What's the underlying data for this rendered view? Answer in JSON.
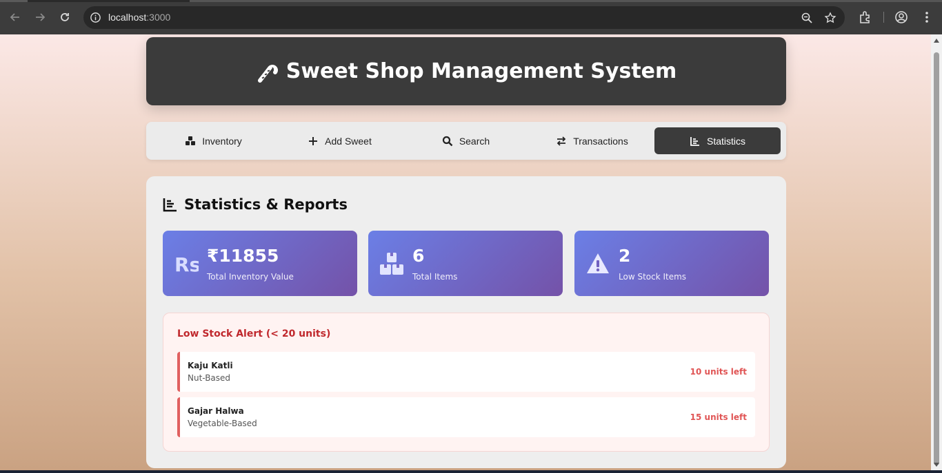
{
  "browser": {
    "url_host": "localhost",
    "url_port": ":3000"
  },
  "header": {
    "title": "Sweet Shop Management System",
    "icon": "candy-cane-icon"
  },
  "nav": {
    "tabs": [
      {
        "label": "Inventory",
        "icon": "boxes-icon",
        "active": false
      },
      {
        "label": "Add Sweet",
        "icon": "plus-icon",
        "active": false
      },
      {
        "label": "Search",
        "icon": "search-icon",
        "active": false
      },
      {
        "label": "Transactions",
        "icon": "swap-arrows-icon",
        "active": false
      },
      {
        "label": "Statistics",
        "icon": "chart-icon",
        "active": true
      }
    ]
  },
  "panel": {
    "title": "Statistics & Reports",
    "stats": [
      {
        "value": "₹11855",
        "label": "Total Inventory Value",
        "icon": "rupee-icon"
      },
      {
        "value": "6",
        "label": "Total Items",
        "icon": "boxes-icon"
      },
      {
        "value": "2",
        "label": "Low Stock Items",
        "icon": "warning-icon"
      }
    ],
    "alert": {
      "title": "Low Stock Alert (< 20 units)",
      "items": [
        {
          "name": "Kaju Katli",
          "category": "Nut-Based",
          "units": "10 units left"
        },
        {
          "name": "Gajar Halwa",
          "category": "Vegetable-Based",
          "units": "15 units left"
        }
      ]
    }
  },
  "colors": {
    "header_bg": "#3b3b3b",
    "active_tab_bg": "#3b3b3b",
    "stat_gradient_start": "#6b7fe6",
    "stat_gradient_end": "#7452a8",
    "alert_red": "#c0282d",
    "units_red": "#e05555"
  }
}
